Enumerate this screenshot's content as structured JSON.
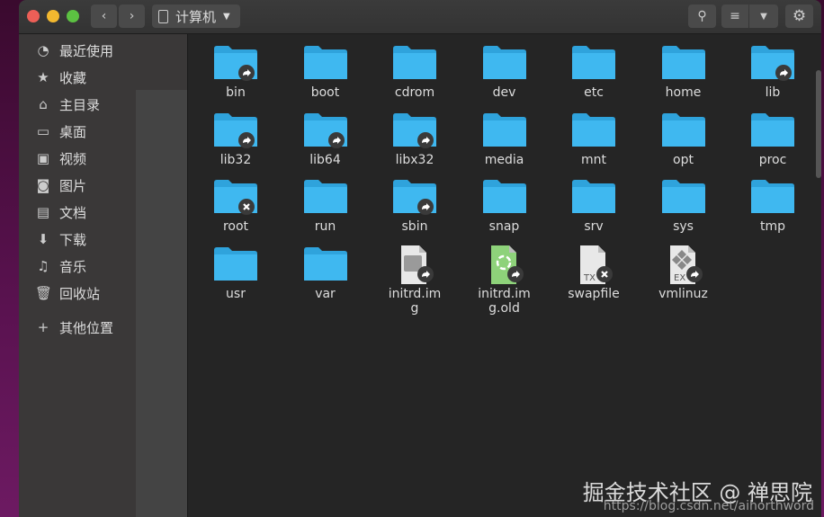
{
  "window": {
    "location": "计算机"
  },
  "sidebar": {
    "items": [
      {
        "label": "最近使用",
        "icon": "clock-icon",
        "glyph": "◔"
      },
      {
        "label": "收藏",
        "icon": "star-icon",
        "glyph": "★"
      },
      {
        "label": "主目录",
        "icon": "home-icon",
        "glyph": "⌂"
      },
      {
        "label": "桌面",
        "icon": "desktop-icon",
        "glyph": "▭"
      },
      {
        "label": "视频",
        "icon": "video-icon",
        "glyph": "▣"
      },
      {
        "label": "图片",
        "icon": "camera-icon",
        "glyph": "◙"
      },
      {
        "label": "文档",
        "icon": "document-icon",
        "glyph": "▤"
      },
      {
        "label": "下载",
        "icon": "download-icon",
        "glyph": "⬇"
      },
      {
        "label": "音乐",
        "icon": "music-icon",
        "glyph": "♫"
      },
      {
        "label": "回收站",
        "icon": "trash-icon",
        "glyph": "🗑"
      }
    ],
    "other": {
      "label": "其他位置",
      "glyph": "+"
    }
  },
  "files": [
    {
      "name": "bin",
      "type": "folder",
      "emblem": "link"
    },
    {
      "name": "boot",
      "type": "folder"
    },
    {
      "name": "cdrom",
      "type": "folder"
    },
    {
      "name": "dev",
      "type": "folder"
    },
    {
      "name": "etc",
      "type": "folder"
    },
    {
      "name": "home",
      "type": "folder"
    },
    {
      "name": "lib",
      "type": "folder",
      "emblem": "link"
    },
    {
      "name": "lib32",
      "type": "folder",
      "emblem": "link"
    },
    {
      "name": "lib64",
      "type": "folder",
      "emblem": "link"
    },
    {
      "name": "libx32",
      "type": "folder",
      "emblem": "link"
    },
    {
      "name": "media",
      "type": "folder"
    },
    {
      "name": "mnt",
      "type": "folder"
    },
    {
      "name": "opt",
      "type": "folder"
    },
    {
      "name": "proc",
      "type": "folder"
    },
    {
      "name": "root",
      "type": "folder",
      "emblem": "locked"
    },
    {
      "name": "run",
      "type": "folder"
    },
    {
      "name": "sbin",
      "type": "folder",
      "emblem": "link"
    },
    {
      "name": "snap",
      "type": "folder"
    },
    {
      "name": "srv",
      "type": "folder"
    },
    {
      "name": "sys",
      "type": "folder"
    },
    {
      "name": "tmp",
      "type": "folder"
    },
    {
      "name": "usr",
      "type": "folder"
    },
    {
      "name": "var",
      "type": "folder"
    },
    {
      "name": "initrd.img",
      "type": "disk",
      "emblem": "link"
    },
    {
      "name": "initrd.img.old",
      "type": "archive",
      "emblem": "link"
    },
    {
      "name": "swapfile",
      "type": "text",
      "badge": "TX",
      "emblem": "locked"
    },
    {
      "name": "vmlinuz",
      "type": "exec",
      "badge": "EX",
      "emblem": "link"
    }
  ],
  "watermark": {
    "line1": "掘金技术社区 @ 禅思院",
    "line2": "https://blog.csdn.net/aihorthword"
  },
  "colors": {
    "folder": "#3fb8f0",
    "folder_tab": "#2fa3dc",
    "close": "#ec5f57",
    "minimize": "#f3b82f",
    "maximize": "#5cc142"
  }
}
